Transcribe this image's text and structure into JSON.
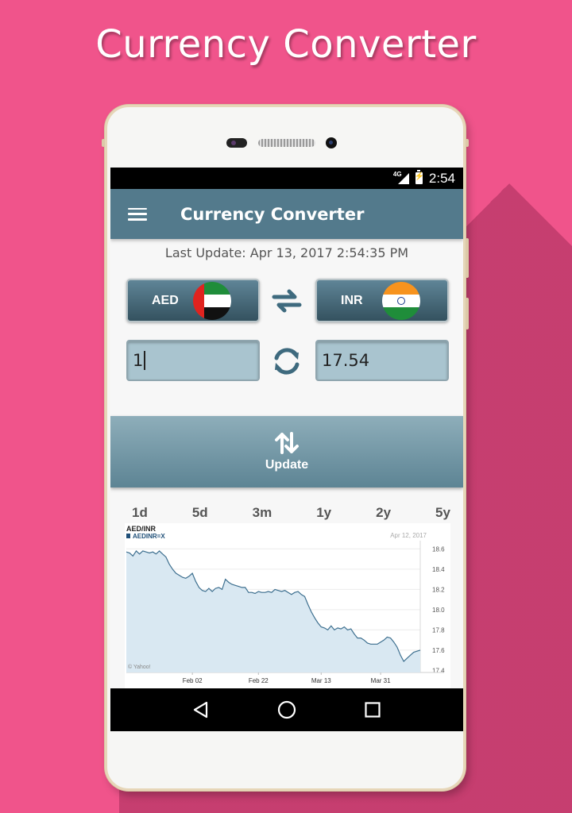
{
  "promo": {
    "title": "Currency Converter"
  },
  "status": {
    "network": "4G",
    "time": "2:54"
  },
  "appbar": {
    "title": "Currency Converter"
  },
  "last_update": "Last Update: Apr 13, 2017 2:54:35 PM",
  "converter": {
    "from_code": "AED",
    "to_code": "INR",
    "from_amount": "1",
    "to_amount": "17.54"
  },
  "update_button": {
    "label": "Update"
  },
  "range_tabs": [
    "1d",
    "5d",
    "3m",
    "1y",
    "2y",
    "5y"
  ],
  "icons": [
    "menu-icon",
    "swap-icon",
    "refresh-icon",
    "update-arrows-icon",
    "back-icon",
    "home-icon",
    "recents-icon"
  ],
  "colors": {
    "background": "#f0548b",
    "appbar": "#537a8c",
    "amount_field": "#a9c4cf",
    "chart_line": "#3d6f8f",
    "chart_fill": "#d9e8f2"
  },
  "chart_data": {
    "type": "area",
    "title": "AED/INR",
    "legend": "AEDINR=X",
    "date_label": "Apr 12, 2017",
    "source": "© Yahoo!",
    "x_ticks": [
      "Feb 02",
      "Feb 22",
      "Mar 13",
      "Mar 31"
    ],
    "y_ticks": [
      18.6,
      18.4,
      18.2,
      18.0,
      17.8,
      17.6,
      17.4
    ],
    "ylim": [
      17.38,
      18.65
    ],
    "x": [
      "Jan 13",
      "Jan 14",
      "Jan 15",
      "Jan 16",
      "Jan 17",
      "Jan 18",
      "Jan 19",
      "Jan 20",
      "Jan 21",
      "Jan 22",
      "Jan 23",
      "Jan 24",
      "Jan 25",
      "Jan 26",
      "Jan 27",
      "Jan 28",
      "Jan 29",
      "Jan 30",
      "Jan 31",
      "Feb 01",
      "Feb 02",
      "Feb 03",
      "Feb 04",
      "Feb 05",
      "Feb 06",
      "Feb 07",
      "Feb 08",
      "Feb 09",
      "Feb 10",
      "Feb 11",
      "Feb 12",
      "Feb 13",
      "Feb 14",
      "Feb 15",
      "Feb 16",
      "Feb 17",
      "Feb 18",
      "Feb 19",
      "Feb 20",
      "Feb 21",
      "Feb 22",
      "Feb 23",
      "Feb 24",
      "Feb 25",
      "Feb 26",
      "Feb 27",
      "Feb 28",
      "Mar 01",
      "Mar 02",
      "Mar 03",
      "Mar 04",
      "Mar 05",
      "Mar 06",
      "Mar 07",
      "Mar 08",
      "Mar 09",
      "Mar 10",
      "Mar 11",
      "Mar 12",
      "Mar 13",
      "Mar 14",
      "Mar 15",
      "Mar 16",
      "Mar 17",
      "Mar 18",
      "Mar 19",
      "Mar 20",
      "Mar 21",
      "Mar 22",
      "Mar 23",
      "Mar 24",
      "Mar 25",
      "Mar 26",
      "Mar 27",
      "Mar 28",
      "Mar 29",
      "Mar 30",
      "Mar 31",
      "Apr 01",
      "Apr 02",
      "Apr 03",
      "Apr 04",
      "Apr 05",
      "Apr 06",
      "Apr 07",
      "Apr 08",
      "Apr 09",
      "Apr 10",
      "Apr 11",
      "Apr 12"
    ],
    "values": [
      18.57,
      18.56,
      18.53,
      18.58,
      18.55,
      18.58,
      18.57,
      18.56,
      18.57,
      18.55,
      18.58,
      18.55,
      18.52,
      18.45,
      18.4,
      18.36,
      18.34,
      18.32,
      18.31,
      18.33,
      18.36,
      18.28,
      18.22,
      18.19,
      18.18,
      18.21,
      18.18,
      18.21,
      18.22,
      18.2,
      18.3,
      18.27,
      18.25,
      18.24,
      18.23,
      18.22,
      18.22,
      18.17,
      18.17,
      18.16,
      18.18,
      18.17,
      18.17,
      18.18,
      18.17,
      18.2,
      18.19,
      18.18,
      18.19,
      18.17,
      18.15,
      18.17,
      18.18,
      18.15,
      18.13,
      18.05,
      17.98,
      17.92,
      17.87,
      17.83,
      17.82,
      17.8,
      17.84,
      17.8,
      17.82,
      17.81,
      17.83,
      17.8,
      17.81,
      17.76,
      17.72,
      17.72,
      17.7,
      17.67,
      17.66,
      17.66,
      17.66,
      17.68,
      17.7,
      17.73,
      17.72,
      17.68,
      17.63,
      17.55,
      17.49,
      17.52,
      17.55,
      17.58,
      17.59,
      17.6
    ]
  }
}
